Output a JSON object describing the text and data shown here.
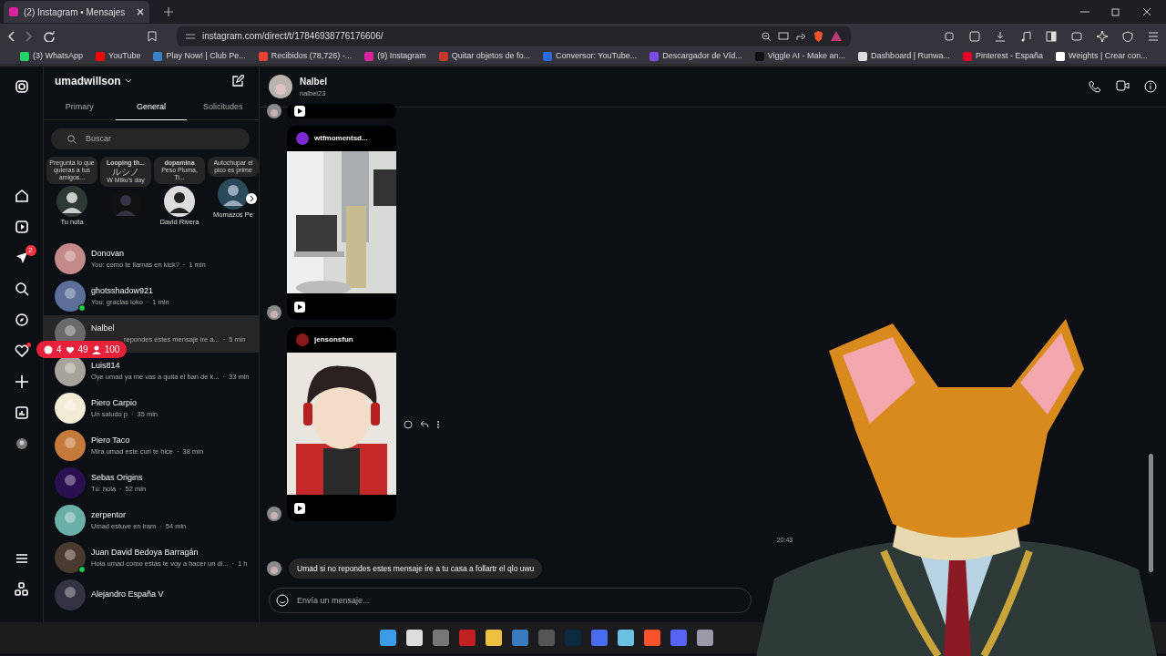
{
  "browser": {
    "tab_title": "(2) Instagram • Mensajes",
    "url": "instagram.com/direct/t/17846938776176606/",
    "bookmarks": [
      {
        "label": "(3) WhatsApp",
        "color": "#25d366"
      },
      {
        "label": "YouTube",
        "color": "#ff0000"
      },
      {
        "label": "Play Now! | Club Pe...",
        "color": "#3b82c4"
      },
      {
        "label": "Recibidos (78,726) -...",
        "color": "#ea4335"
      },
      {
        "label": "(9) Instagram",
        "color": "#d6249f"
      },
      {
        "label": "Quitar objetos de fo...",
        "color": "#c0392b"
      },
      {
        "label": "Conversor: YouTube...",
        "color": "#2d6cdf"
      },
      {
        "label": "Descargador de Víd...",
        "color": "#7b4cf5"
      },
      {
        "label": "Viggle AI - Make an...",
        "color": "#111111"
      },
      {
        "label": "Dashboard | Runwa...",
        "color": "#dddddd"
      },
      {
        "label": "Pinterest - España",
        "color": "#e60023"
      },
      {
        "label": "Weights | Crear con...",
        "color": "#ffffff"
      }
    ]
  },
  "instagram": {
    "username": "umadwillson",
    "messages_badge": "2",
    "separator": "·",
    "tabs": [
      {
        "label": "Primary",
        "selected": false
      },
      {
        "label": "General",
        "selected": true
      },
      {
        "label": "Solicitudes",
        "selected": false
      }
    ],
    "search": {
      "placeholder": "Buscar"
    },
    "notes": [
      {
        "lines": [
          "Pregunta lo que quieras a tus amigos..."
        ],
        "name": "Tu nota"
      },
      {
        "lines": [
          "Looping th...",
          "ルシノ",
          "W Miku's day"
        ]
      },
      {
        "lines": [
          "dopamina",
          "Peso Pluma, Ti..."
        ],
        "name": "David Rivera"
      },
      {
        "lines": [
          "Autochupar el pico es prime"
        ],
        "name": "Momazos Pe"
      }
    ],
    "conversations": [
      {
        "name": "Donovan",
        "preview": "You: como te llamas en kick?",
        "time": "1 min",
        "online": false,
        "selected": false
      },
      {
        "name": "ghotsshadow921",
        "preview": "You: gracias loko",
        "time": "1 min",
        "online": true,
        "selected": false
      },
      {
        "name": "Nalbel",
        "preview": "repondes estes mensaje ire a...",
        "time": "5 min",
        "online": false,
        "selected": true,
        "stream_badge": {
          "comments": "4",
          "likes": "49",
          "viewers": "100"
        }
      },
      {
        "name": "Luis814",
        "preview": "Oye umad ya me vas a quita el ban de k...",
        "time": "33 min",
        "online": false,
        "selected": false
      },
      {
        "name": "Piero Carpio",
        "preview": "Un saludo p",
        "time": "35 min",
        "online": false,
        "selected": false
      },
      {
        "name": "Piero Taco",
        "preview": "Mira umad este curi te hice",
        "time": "38 min",
        "online": false,
        "selected": false
      },
      {
        "name": "Sebas Origins",
        "preview": "Tú: hola",
        "time": "52 min",
        "online": false,
        "selected": false
      },
      {
        "name": "zerpentor",
        "preview": "Umad estuve en iram",
        "time": "54 min",
        "online": false,
        "selected": false
      },
      {
        "name": "Juan David Bedoya Barragán",
        "preview": "Hola umad como estás te voy a hacer un di...",
        "time": "1 h",
        "online": true,
        "selected": false
      },
      {
        "name": "Alejandro España V",
        "online": false,
        "selected": false
      }
    ]
  },
  "chat": {
    "name": "Nalbel",
    "handle": "nalbel23",
    "posts": [
      {
        "kind": "cut"
      },
      {
        "kind": "post",
        "author": "wtfmomentsd..."
      },
      {
        "kind": "post",
        "author": "jensonsfun"
      }
    ],
    "time": "20:43",
    "message": "Umad si no repondes estes mensaje ire a tu casa a follartr el qlo uwu",
    "input": {
      "placeholder": "Envía un mensaje..."
    }
  }
}
